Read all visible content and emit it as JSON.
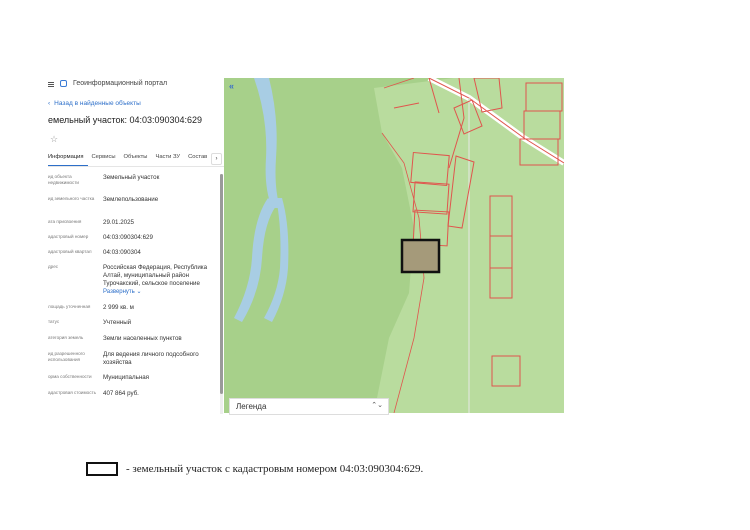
{
  "app": {
    "title": "Геоинформационный портал"
  },
  "nav": {
    "back_label": "Назад в найденные объекты"
  },
  "object": {
    "title": "емельный участок: 04:03:090304:629"
  },
  "tabs": [
    "Информация",
    "Сервисы",
    "Объекты",
    "Части ЗУ",
    "Состав"
  ],
  "fields": [
    {
      "label": "ид объекта недвижимости",
      "value": "Земельный участок"
    },
    {
      "label": "ид земельного частка",
      "value": "Землепользование"
    },
    {
      "label": "ата присвоения",
      "value": "29.01.2025"
    },
    {
      "label": "адастровый номер",
      "value": "04:03:090304:629"
    },
    {
      "label": "адастровый квартал",
      "value": "04:03:090304"
    },
    {
      "label": "дрес",
      "value": "Российская Федерация, Республика Алтай, муниципальный район Турочакский, сельское поселение"
    },
    {
      "label": "лощадь уточненная",
      "value": "2 999 кв. м"
    },
    {
      "label": "татус",
      "value": "Учтенный"
    },
    {
      "label": "атегория земель",
      "value": "Земли населенных пунктов"
    },
    {
      "label": "ид разрешенного использования",
      "value": "Для ведения личного подсобного хозяйства"
    },
    {
      "label": "орма собственности",
      "value": "Муниципальная"
    },
    {
      "label": "адастровая стоимость",
      "value": "407 864 руб."
    }
  ],
  "address_more_label": "Развернуть",
  "map": {
    "collapse_label": "«",
    "legend_label": "Легенда",
    "legend_toggle": "⌃⌄"
  },
  "caption": {
    "text": "- земельный участок с кадастровым номером 04:03:090304:629."
  },
  "colors": {
    "map_green": "#a7d08a",
    "map_light_green": "#b9dc9e",
    "river": "#a8cde4",
    "parcel_outline": "#e0554d",
    "selected_parcel": "#a59a7a",
    "accent": "#2d6fc9"
  }
}
